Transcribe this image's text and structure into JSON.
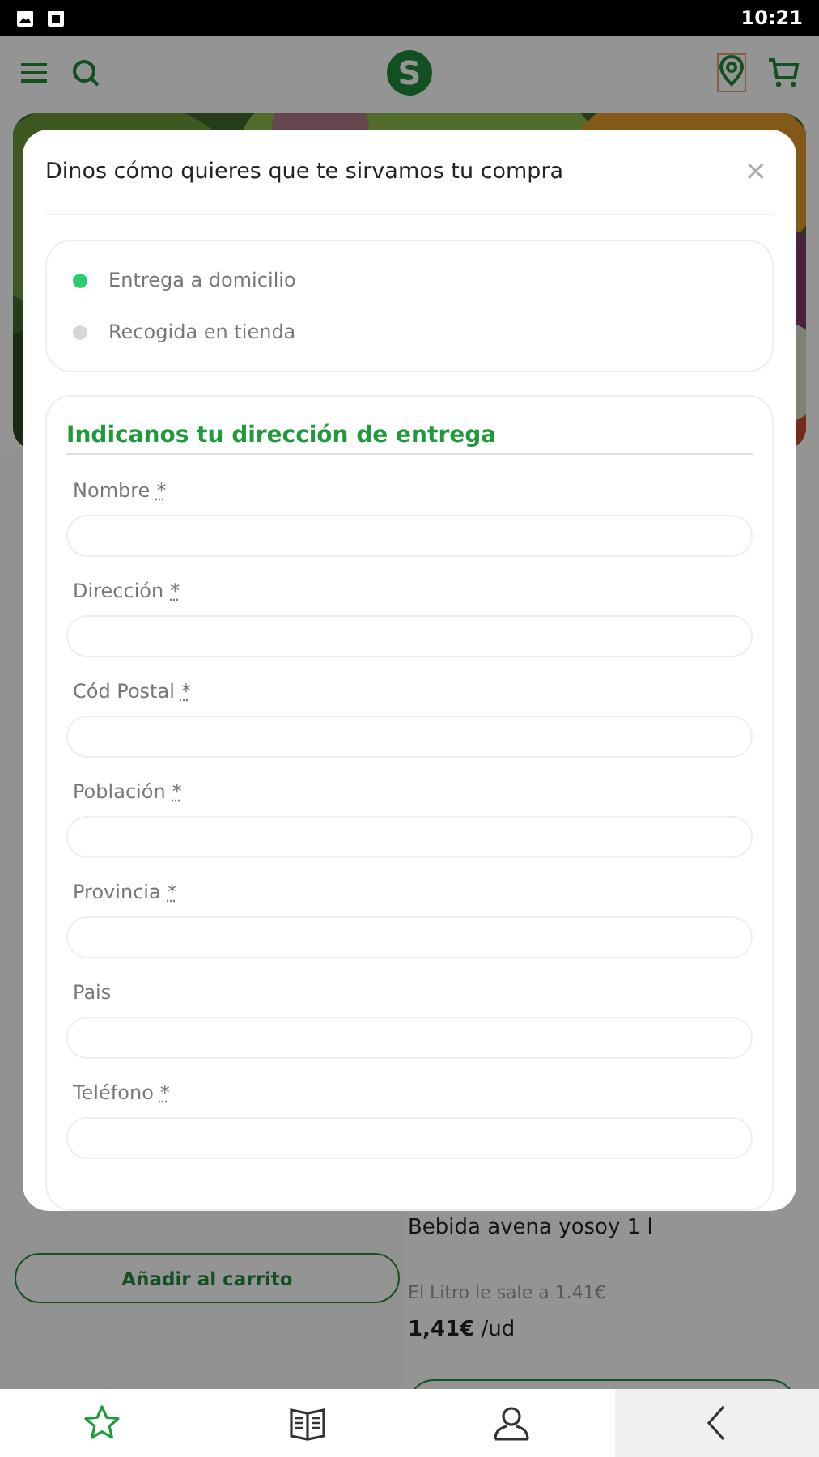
{
  "status_bar": {
    "time": "10:21"
  },
  "header": {
    "logo": "S"
  },
  "background_products": [
    {
      "button": "Añadir al carrito"
    },
    {
      "name": "Bebida avena yosoy 1 l",
      "unit_price": "El Litro le sale a 1.41€",
      "price": "1,41€",
      "unit": "/ud"
    }
  ],
  "modal": {
    "title": "Dinos cómo quieres que te sirvamos tu compra",
    "close": "×",
    "delivery_options": [
      {
        "label": "Entrega a domicilio",
        "selected": true
      },
      {
        "label": "Recogida en tienda",
        "selected": false
      }
    ],
    "address_form": {
      "title": "Indicanos tu dirección de entrega",
      "fields": [
        {
          "label": "Nombre",
          "required_mark": "*"
        },
        {
          "label": "Dirección",
          "required_mark": "*"
        },
        {
          "label": "Cód Postal",
          "required_mark": "*"
        },
        {
          "label": "Población",
          "required_mark": "*"
        },
        {
          "label": "Provincia",
          "required_mark": "*"
        },
        {
          "label": "Pais"
        },
        {
          "label": "Teléfono",
          "required_mark": "*"
        }
      ]
    }
  },
  "bottom_nav": [
    {
      "kind": "star",
      "selected": true
    },
    {
      "kind": "catalog",
      "selected": false
    },
    {
      "kind": "account",
      "selected": false
    },
    {
      "kind": "back",
      "selected": false
    }
  ]
}
